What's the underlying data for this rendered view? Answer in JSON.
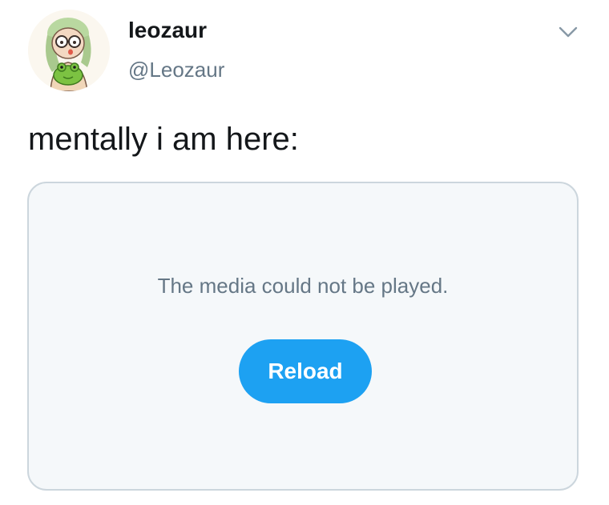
{
  "tweet": {
    "author": {
      "display_name": "leozaur",
      "handle": "@Leozaur"
    },
    "text": "mentally i am here:",
    "media": {
      "error_message": "The media could not be played.",
      "reload_label": "Reload"
    }
  },
  "icons": {
    "menu": "chevron-down-icon",
    "avatar": "cartoon-girl-with-frog-avatar"
  },
  "colors": {
    "primary_text": "#14171a",
    "secondary_text": "#657786",
    "accent_blue": "#1da1f2",
    "card_border": "#ccd6dd",
    "card_background": "#f5f8fa"
  }
}
